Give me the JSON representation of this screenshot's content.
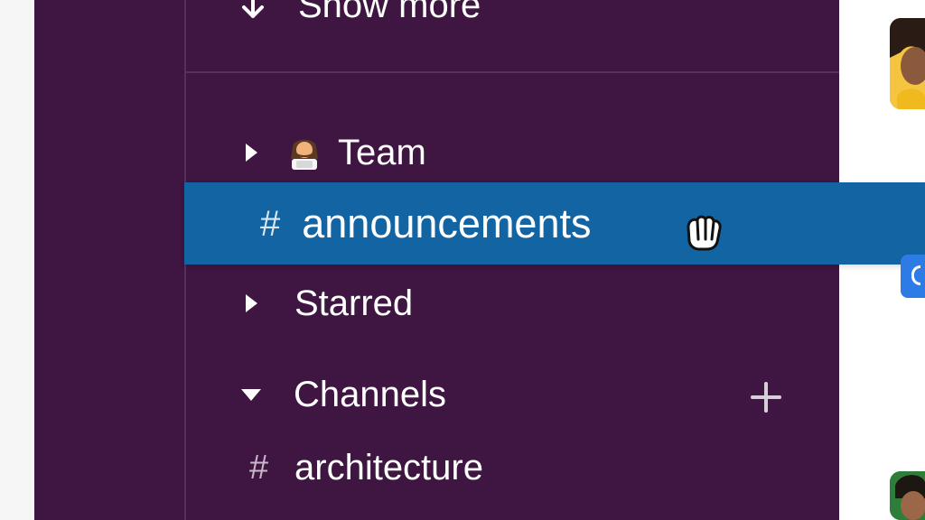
{
  "sidebar": {
    "show_more": {
      "label": "Show more",
      "icon": "arrow-down-icon"
    },
    "sections": [
      {
        "name": "Team",
        "emoji": "woman-technologist-emoji",
        "collapsed": true
      },
      {
        "name": "Starred",
        "collapsed": true
      },
      {
        "name": "Channels",
        "collapsed": false,
        "add_icon": "plus-icon",
        "items": [
          {
            "prefix": "#",
            "label": "architecture"
          }
        ]
      }
    ],
    "dragging_item": {
      "prefix": "#",
      "label": "announcements",
      "cursor": "grab-hand-icon"
    }
  },
  "colors": {
    "sidebar_bg": "#3f1541",
    "drag_highlight": "#1264a3",
    "text": "#ffffff",
    "divider": "#55305a",
    "badge_blue": "#2d7be5"
  }
}
